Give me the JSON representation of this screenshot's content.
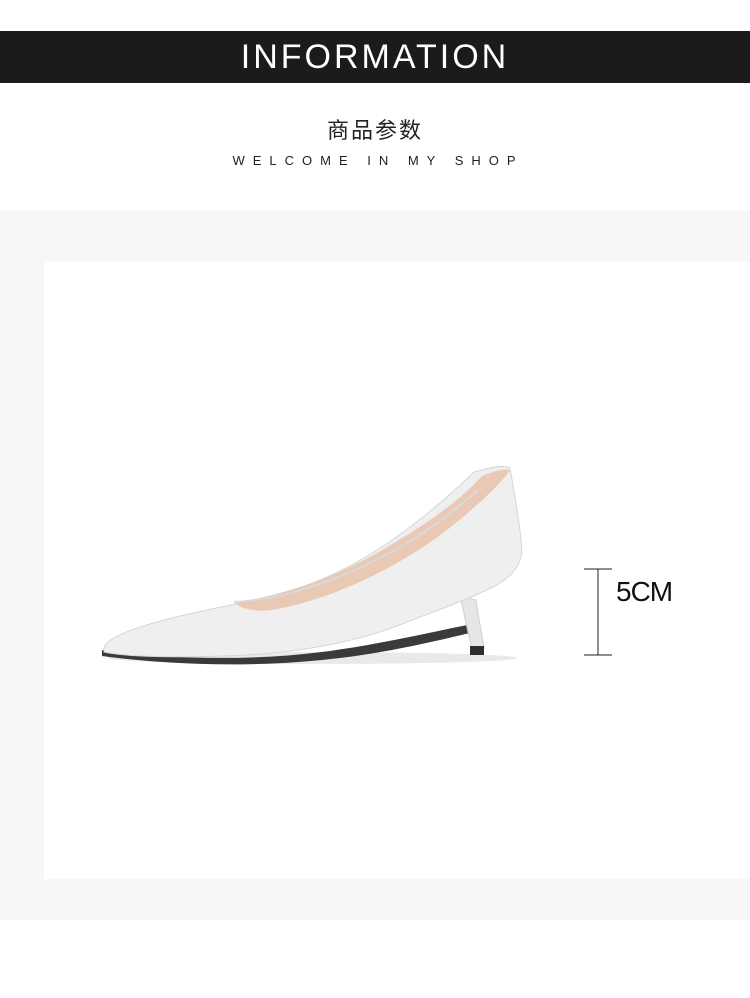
{
  "banner": {
    "title": "INFORMATION",
    "background": "#1b1b1b",
    "text_color": "#ffffff"
  },
  "section": {
    "title": "商品参数",
    "subtitle": "WELCOME IN MY SHOP"
  },
  "product": {
    "image_icon": "white-pointed-toe-pump-image",
    "color": "#efefef"
  },
  "measurement": {
    "heel_height": "5CM",
    "icon": "height-measure-icon"
  }
}
